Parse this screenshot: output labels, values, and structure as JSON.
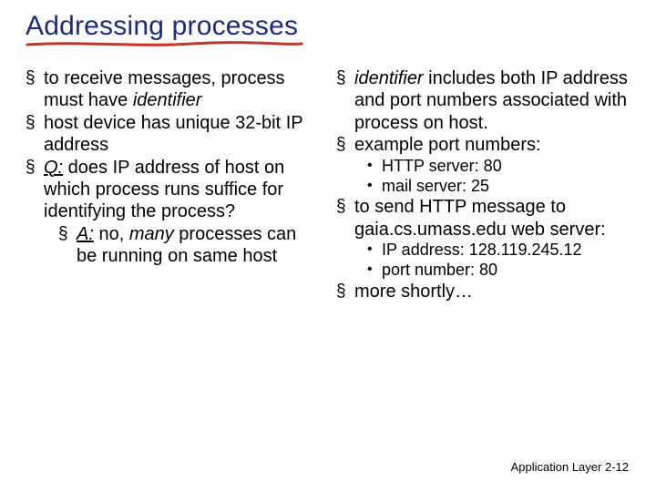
{
  "title": "Addressing processes",
  "colors": {
    "title": "#1d2b7a",
    "underline": "#c0362c"
  },
  "left": {
    "b1_a": "to receive messages, process must have ",
    "b1_b": "identifier",
    "b2": "host device has unique 32-bit IP address",
    "b3_a": "Q:",
    "b3_b": " does IP address of host on which process runs suffice for identifying the process?",
    "b3s_a": "A:",
    "b3s_b": " no, ",
    "b3s_c": "many",
    "b3s_d": " processes can be running on same host"
  },
  "right": {
    "b1_a": "identifier",
    "b1_b": " includes both IP address and port numbers associated with process on host.",
    "b2": "example port numbers:",
    "b2d1": "HTTP server: 80",
    "b2d2": "mail server: 25",
    "b3": "to send HTTP message to gaia.cs.umass.edu web server:",
    "b3d1": "IP address: 128.119.245.12",
    "b3d2": "port number: 80",
    "b4": "more shortly…"
  },
  "footer": {
    "label": "Application Layer",
    "page": "2-12"
  }
}
